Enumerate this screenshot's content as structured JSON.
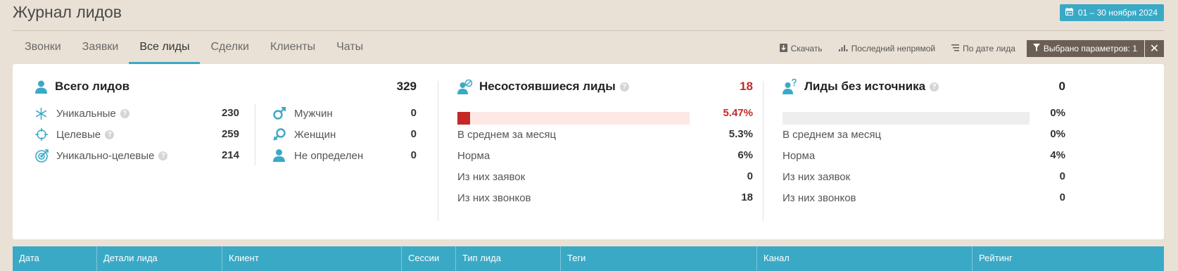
{
  "page": {
    "title": "Журнал лидов"
  },
  "date_range": {
    "label": "01 – 30 ноября 2024",
    "icon": "calendar-icon"
  },
  "tabs": [
    {
      "label": "Звонки",
      "active": false
    },
    {
      "label": "Заявки",
      "active": false
    },
    {
      "label": "Все лиды",
      "active": true
    },
    {
      "label": "Сделки",
      "active": false
    },
    {
      "label": "Клиенты",
      "active": false
    },
    {
      "label": "Чаты",
      "active": false
    }
  ],
  "toolbar": {
    "download": "Скачать",
    "attribution": "Последний непрямой",
    "sort": "По дате лида",
    "filter": "Выбрано параметров: 1",
    "filter_close": "✕"
  },
  "total": {
    "title": "Всего лидов",
    "value": "329",
    "rows": [
      {
        "label": "Уникальные",
        "value": "230",
        "help": true,
        "icon": "asterisk-icon"
      },
      {
        "label": "Целевые",
        "value": "259",
        "help": true,
        "icon": "crosshair-icon"
      },
      {
        "label": "Уникально-целевые",
        "value": "214",
        "help": true,
        "icon": "target-arrow-icon"
      }
    ],
    "gender": [
      {
        "label": "Мужчин",
        "value": "0",
        "icon": "male-icon"
      },
      {
        "label": "Женщин",
        "value": "0",
        "icon": "female-icon"
      },
      {
        "label": "Не определен",
        "value": "0",
        "icon": "person-icon"
      }
    ]
  },
  "failed": {
    "title": "Несостоявшиеся лиды",
    "value": "18",
    "percent": "5.47%",
    "fill_fraction": 0.0547,
    "bar_color": "#c62828",
    "bar_bg": "#fde8e6",
    "rows": [
      {
        "label": "В среднем за месяц",
        "value": "5.3%"
      },
      {
        "label": "Норма",
        "value": "6%"
      },
      {
        "label": "Из них заявок",
        "value": "0"
      },
      {
        "label": "Из них звонков",
        "value": "18"
      }
    ]
  },
  "nosource": {
    "title": "Лиды без источника",
    "value": "0",
    "percent": "0%",
    "fill_fraction": 0,
    "bar_color": "#cccccc",
    "bar_bg": "#eeeeee",
    "rows": [
      {
        "label": "В среднем за месяц",
        "value": "0%"
      },
      {
        "label": "Норма",
        "value": "4%"
      },
      {
        "label": "Из них заявок",
        "value": "0"
      },
      {
        "label": "Из них звонков",
        "value": "0"
      }
    ]
  },
  "table": {
    "columns": [
      "Дата",
      "Детали лида",
      "Клиент",
      "Сессии",
      "Тип лида",
      "Теги",
      "Канал",
      "Рейтинг"
    ]
  },
  "colors": {
    "accent": "#3aa9c6",
    "danger": "#c62828",
    "dark_button": "#6b5f55",
    "background": "#e9e1d5"
  }
}
